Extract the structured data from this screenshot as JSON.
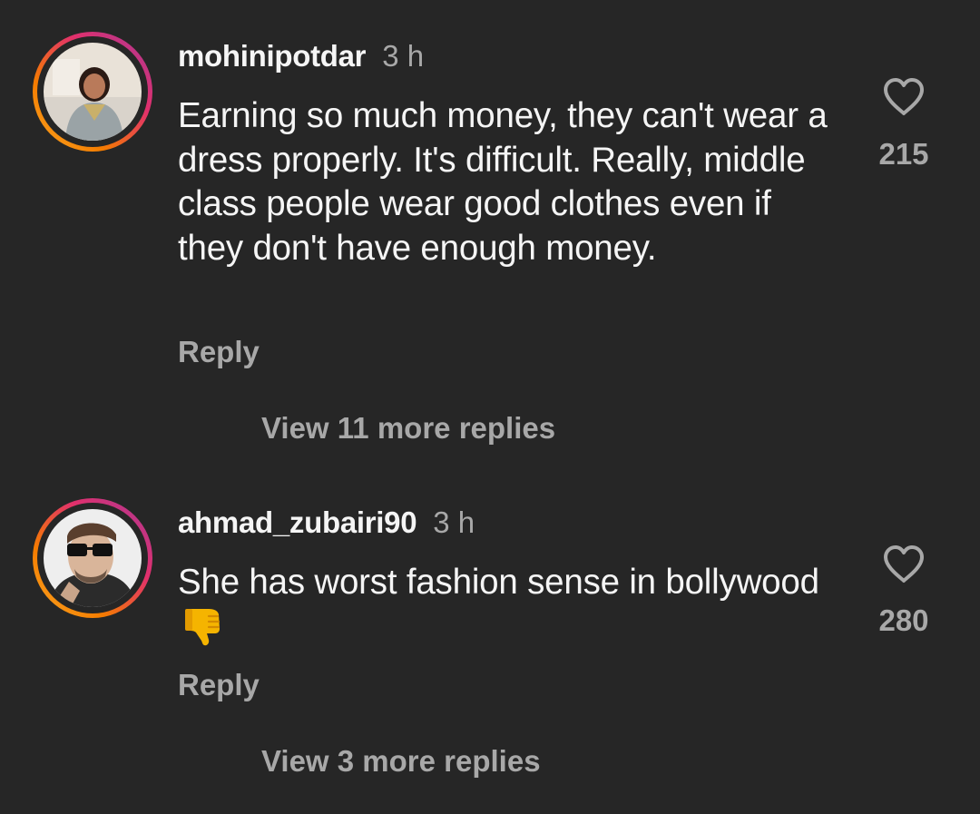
{
  "comments": [
    {
      "username": "mohinipotdar",
      "time": "3 h",
      "text": "Earning so much money, they can't wear a dress properly. It's difficult. Really, middle class people wear good clothes even if they don't have enough money.",
      "reply_label": "Reply",
      "view_replies": "View 11 more replies",
      "likes": "215",
      "avatar_icon": "profile-photo-woman"
    },
    {
      "username": "ahmad_zubairi90",
      "time": "3 h",
      "text": "She has worst fashion sense in bollywood",
      "emoji_icon": "thumbs-down-emoji",
      "reply_label": "Reply",
      "view_replies": "View 3 more replies",
      "likes": "280",
      "avatar_icon": "profile-photo-man-sunglasses"
    }
  ],
  "colors": {
    "background": "#262626",
    "primary_text": "#f5f5f5",
    "secondary_text": "#a8a8a8",
    "story_ring_start": "#f9a825",
    "story_ring_end": "#c13584"
  }
}
